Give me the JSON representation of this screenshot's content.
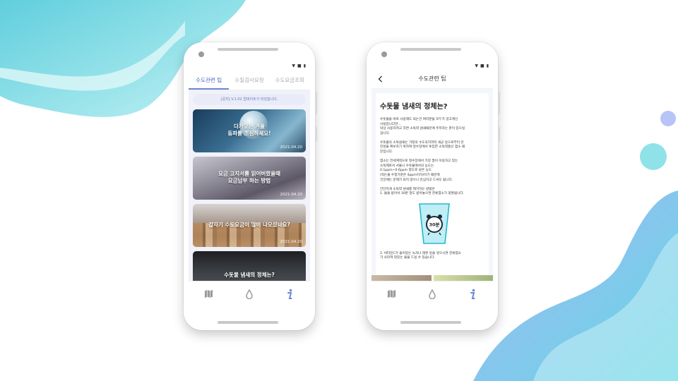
{
  "colors": {
    "accent": "#6b86d6",
    "tab_active": "#4a68b8",
    "list_background": "#f1f2f9",
    "bg_teal": "#5fd3de",
    "bg_blue": "#a3b6f3"
  },
  "left_phone": {
    "tabs": [
      {
        "label": "수도관련 팁",
        "active": true
      },
      {
        "label": "수질검사요청",
        "active": false
      },
      {
        "label": "수도요금조회",
        "active": false
      }
    ],
    "notice": "[공지] V.1.02 업데이트가 되었습니다.",
    "cards": [
      {
        "title": "다가오는 겨울\n동파를 조심하세요!",
        "date": "2021.04.20"
      },
      {
        "title": "요금 고지서를 읽어버렸을때\n요금납부 하는 방법",
        "date": "2021.04.20"
      },
      {
        "title": "갑자기 수도요금이 많이 나오셨나요?",
        "date": "2021.04.20"
      },
      {
        "title": "수돗물 냄새의 정체는?",
        "date": ""
      }
    ],
    "nav": [
      {
        "icon": "map-icon",
        "active": false
      },
      {
        "icon": "water-drop-icon",
        "active": false
      },
      {
        "icon": "info-icon",
        "active": true
      }
    ]
  },
  "right_phone": {
    "header_title": "수도관련 팁",
    "article": {
      "title": "수돗물 냄새의 정체는?",
      "paragraphs": [
        [
          "수돗물을 바로 사용해도 되는건 여러분들 모두가 알고계신",
          "사실입니다만...",
          "막상 사용하려고 하면 소독약 냄새때문에 주저하는 분이 있으실",
          "겁니다."
        ],
        [
          "수돗물의 소독냄새는 가정의 수도꼭지까지 세균 등으로부터 안",
          "전성을 확보하기 위하여 정수장에서 투입한 소독약품인 염소 때",
          "문입니다."
        ],
        [
          "염소는 전세계적으로 정수장에서 가장 많이 이용하고 있는",
          "소독제로서 서울시 수돗물에서의 농도는",
          "0.1ppm~0.6ppm 정도로 낮은 농도",
          "(먹는물 수질기준은 4ppm이하)이기 때문에",
          "건강에는 문제가 되지 않으니 안심하고 드셔도 됩니다."
        ],
        [
          "간단하게 소독약 냄새를 제거하는 방법은",
          "  1. 물을 받아서 30분 정도 받아놓으면 잔류염소가 휘발됩니다."
        ]
      ],
      "cup_label": "30분",
      "paragraph_after": [
        "2. 비타민C가 들어있는 녹차나 레몬 등을 넣으시면 잔류염소",
        "   가 사라져 맛있는 물을 드실 수 있습니다."
      ]
    },
    "nav": [
      {
        "icon": "map-icon",
        "active": false
      },
      {
        "icon": "water-drop-icon",
        "active": false
      },
      {
        "icon": "info-icon",
        "active": true
      }
    ]
  }
}
